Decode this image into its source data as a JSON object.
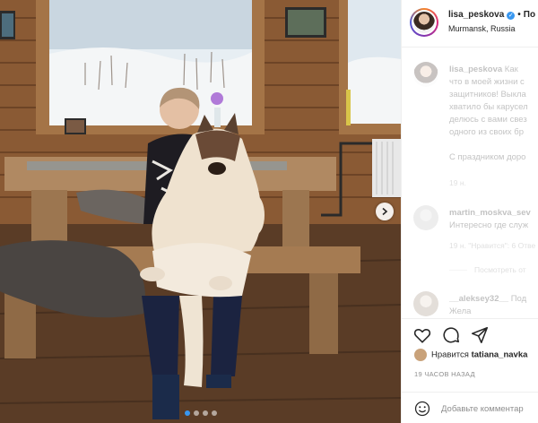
{
  "post": {
    "author": {
      "username": "lisa_peskova",
      "verified": true,
      "location": "Murmansk, Russia",
      "follow_separator": "•",
      "follow_label": "По"
    },
    "photo": {
      "carousel_dots": 4,
      "active_index": 0
    }
  },
  "comments": [
    {
      "username": "lisa_peskova",
      "lines": [
        "Как",
        "что в моей жизни с",
        "защитников! Выкла",
        "хватило бы карусел",
        "делюсь с вами свез",
        "одного из своих бр",
        "",
        "С праздником доро"
      ],
      "meta": "19 н."
    },
    {
      "username": "martin_moskva_sev",
      "lines": [
        "Интересно где служ"
      ],
      "meta": "19 н.  \"Нравится\": 6  Отве",
      "replies": "Посмотреть от"
    },
    {
      "username": "__aleksey32__",
      "lines": [
        "Под",
        "Жела"
      ],
      "meta": ""
    }
  ],
  "likes": {
    "prefix": "Нравится",
    "user": "tatiana_navka"
  },
  "time_ago": "19 ЧАСОВ НАЗАД",
  "add_comment": {
    "placeholder": "Добавьте комментар"
  },
  "icons": {
    "like": "heart-icon",
    "comment": "comment-icon",
    "share": "share-icon",
    "emoji": "emoji-icon",
    "next": "chevron-right-icon",
    "verified": "verified-badge-icon"
  },
  "colors": {
    "accent": "#3897f0",
    "text": "#262626",
    "secondary": "#8e8e8e"
  }
}
